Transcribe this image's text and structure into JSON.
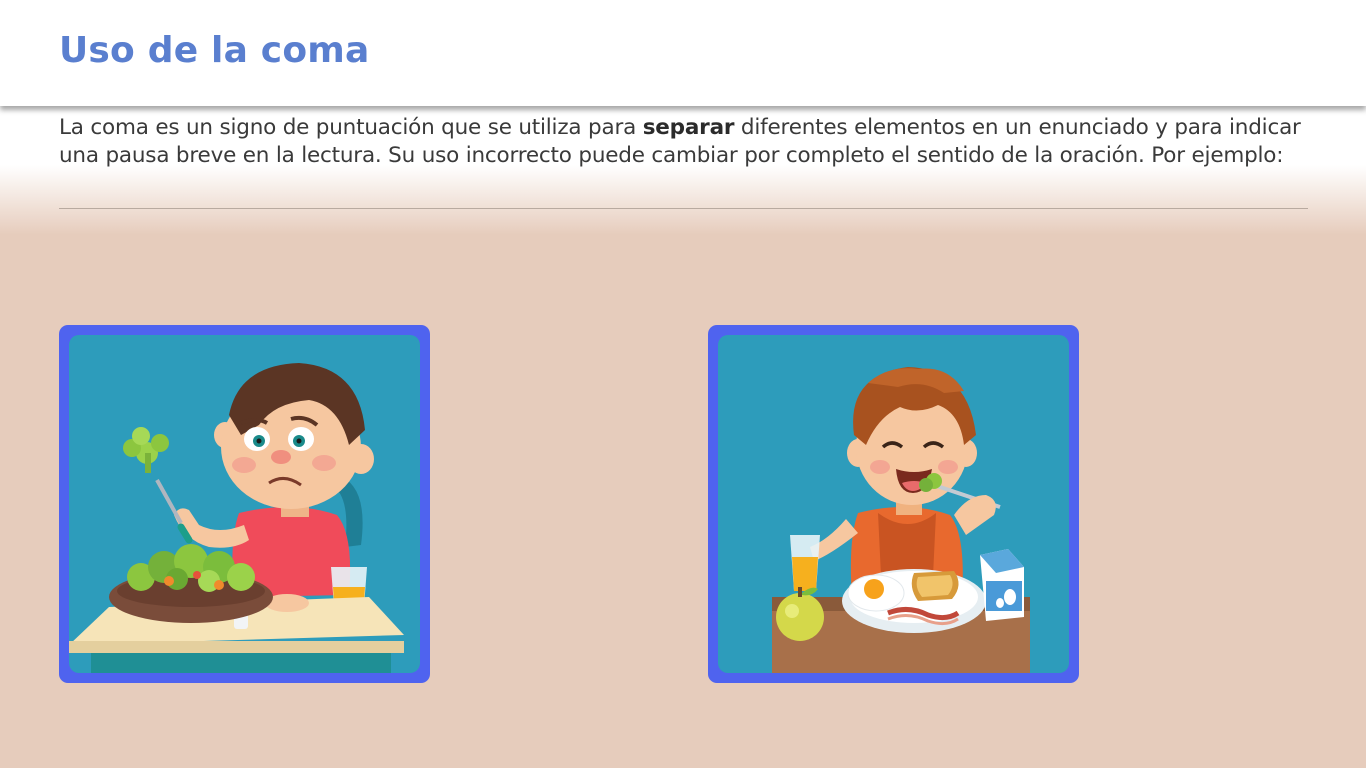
{
  "slide": {
    "title": "Uso de la coma",
    "intro_before": "La coma es un signo de puntuación que se utiliza para ",
    "intro_bold": "separar",
    "intro_after": " diferentes elementos en un enunciado y para indicar una pausa breve en la lectura. Su uso incorrecto puede cambiar por completo el sentido de la oración. Por ejemplo:"
  },
  "colors": {
    "title": "#5a7fcf",
    "card_border": "#4f63ef",
    "card_bg": "#2d9cbb",
    "page_bg": "#e6ccbc"
  },
  "illustrations": [
    {
      "name": "boy-disliking-salad-illustration"
    },
    {
      "name": "boy-enjoying-breakfast-illustration"
    }
  ]
}
